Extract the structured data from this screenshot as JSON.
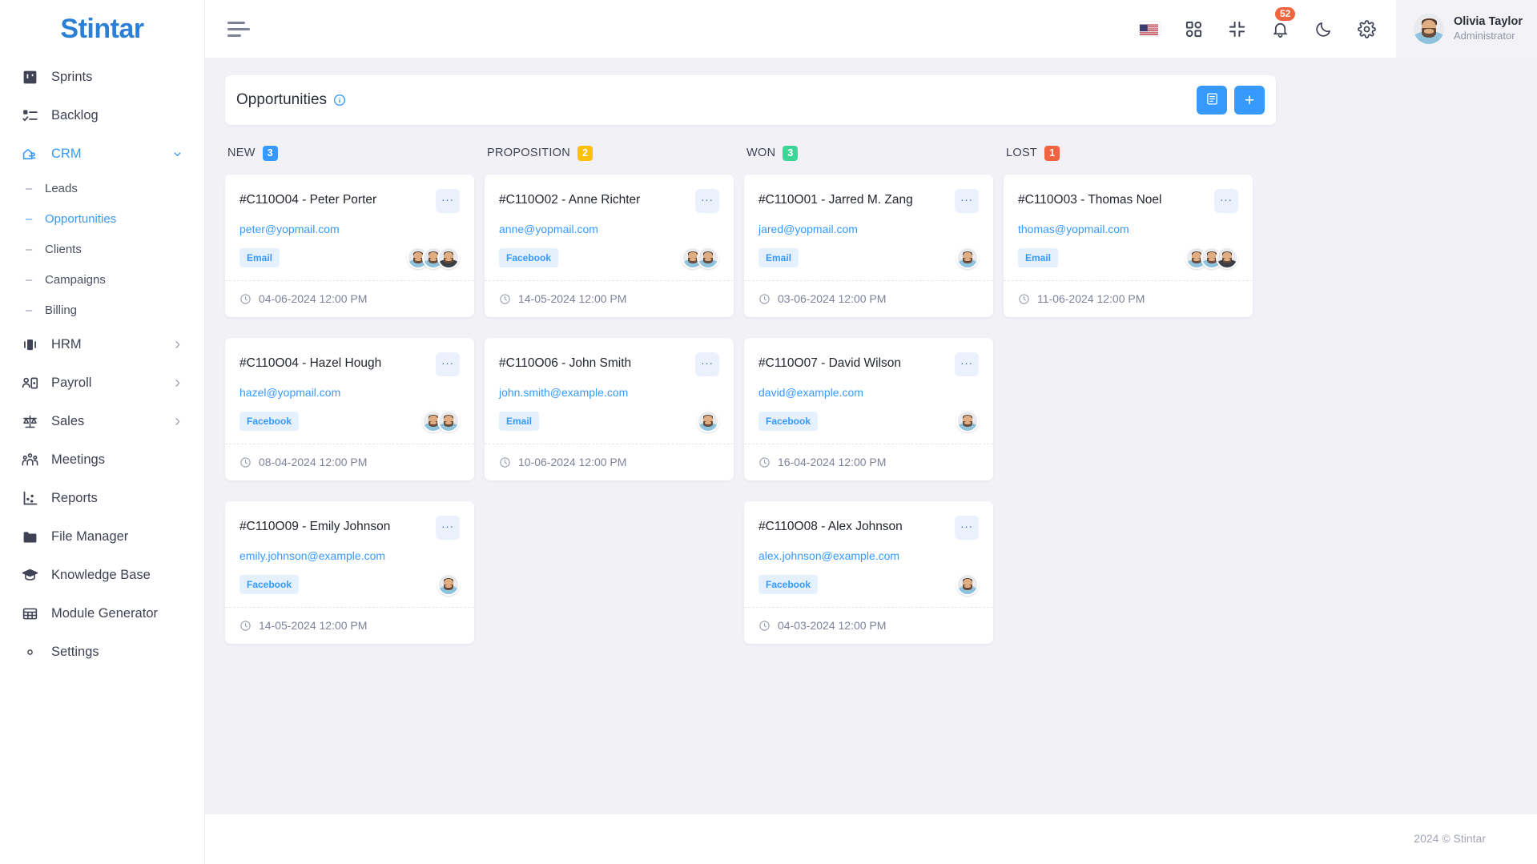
{
  "brand": {
    "name": "Stintar"
  },
  "sidebar": {
    "items": [
      {
        "label": "Sprints",
        "icon": "board-icon",
        "type": "item",
        "active": false
      },
      {
        "label": "Backlog",
        "icon": "checklist-icon",
        "type": "item",
        "active": false
      },
      {
        "label": "CRM",
        "icon": "crm-icon",
        "type": "group",
        "active": true,
        "expanded": true
      },
      {
        "label": "Leads",
        "icon": "dash-icon",
        "type": "sub",
        "active": false
      },
      {
        "label": "Opportunities",
        "icon": "dash-icon",
        "type": "sub",
        "active": true
      },
      {
        "label": "Clients",
        "icon": "dash-icon",
        "type": "sub",
        "active": false
      },
      {
        "label": "Campaigns",
        "icon": "dash-icon",
        "type": "sub",
        "active": false
      },
      {
        "label": "Billing",
        "icon": "dash-icon",
        "type": "sub",
        "active": false
      },
      {
        "label": "HRM",
        "icon": "hrm-icon",
        "type": "group",
        "active": false,
        "expanded": false
      },
      {
        "label": "Payroll",
        "icon": "payroll-icon",
        "type": "group",
        "active": false,
        "expanded": false
      },
      {
        "label": "Sales",
        "icon": "scales-icon",
        "type": "group",
        "active": false,
        "expanded": false
      },
      {
        "label": "Meetings",
        "icon": "people-icon",
        "type": "item",
        "active": false
      },
      {
        "label": "Reports",
        "icon": "chart-icon",
        "type": "item",
        "active": false
      },
      {
        "label": "File Manager",
        "icon": "folder-icon",
        "type": "item",
        "active": false
      },
      {
        "label": "Knowledge Base",
        "icon": "graduation-cap-icon",
        "type": "item",
        "active": false
      },
      {
        "label": "Module Generator",
        "icon": "grid-table-icon",
        "type": "item",
        "active": false
      },
      {
        "label": "Settings",
        "icon": "gear-icon",
        "type": "item",
        "active": false
      }
    ]
  },
  "topbar": {
    "menu_toggle": "hamburger-icon",
    "icons": [
      {
        "name": "language-flag-us",
        "label": "US"
      },
      {
        "name": "apps-grid-icon",
        "label": "Apps"
      },
      {
        "name": "fullscreen-exit-icon",
        "label": "Fullscreen"
      },
      {
        "name": "bell-icon",
        "label": "Notifications",
        "badge": "52"
      },
      {
        "name": "moon-icon",
        "label": "Dark mode"
      },
      {
        "name": "gear-icon",
        "label": "Settings"
      }
    ],
    "notification_count": "52",
    "profile": {
      "name": "Olivia Taylor",
      "role": "Administrator",
      "avatar": "user-avatar"
    }
  },
  "page": {
    "title": "Opportunities",
    "info_icon": "info-icon",
    "actions": [
      {
        "name": "list-view-button",
        "icon": "list-view-icon",
        "label": ""
      },
      {
        "name": "add-opportunity-button",
        "icon": "plus-icon",
        "label": "+"
      }
    ]
  },
  "colors": {
    "new": "#3699ff",
    "proposition": "#ffc107",
    "won": "#3dd598",
    "lost": "#f0653f",
    "accent": "#3699ff"
  },
  "board": {
    "columns": [
      {
        "name": "NEW",
        "count": "3",
        "badge_color": "#3699ff",
        "cards": [
          {
            "title": "#C110O04 - Peter Porter",
            "email": "peter@yopmail.com",
            "tag": "Email",
            "date": "04-06-2024 12:00 PM",
            "avatars": 3,
            "menu": "..."
          },
          {
            "title": "#C110O04 - Hazel Hough",
            "email": "hazel@yopmail.com",
            "tag": "Facebook",
            "date": "08-04-2024 12:00 PM",
            "avatars": 2,
            "menu": "..."
          },
          {
            "title": "#C110O09 - Emily Johnson",
            "email": "emily.johnson@example.com",
            "tag": "Facebook",
            "date": "14-05-2024 12:00 PM",
            "avatars": 1,
            "menu": "..."
          }
        ]
      },
      {
        "name": "PROPOSITION",
        "count": "2",
        "badge_color": "#ffc107",
        "cards": [
          {
            "title": "#C110O02 - Anne Richter",
            "email": "anne@yopmail.com",
            "tag": "Facebook",
            "date": "14-05-2024 12:00 PM",
            "avatars": 2,
            "menu": "..."
          },
          {
            "title": "#C110O06 - John Smith",
            "email": "john.smith@example.com",
            "tag": "Email",
            "date": "10-06-2024 12:00 PM",
            "avatars": 1,
            "menu": "..."
          }
        ]
      },
      {
        "name": "WON",
        "count": "3",
        "badge_color": "#3dd598",
        "cards": [
          {
            "title": "#C110O01 - Jarred M. Zang",
            "email": "jared@yopmail.com",
            "tag": "Email",
            "date": "03-06-2024 12:00 PM",
            "avatars": 1,
            "menu": "..."
          },
          {
            "title": "#C110O07 - David Wilson",
            "email": "david@example.com",
            "tag": "Facebook",
            "date": "16-04-2024 12:00 PM",
            "avatars": 1,
            "menu": "..."
          },
          {
            "title": "#C110O08 - Alex Johnson",
            "email": "alex.johnson@example.com",
            "tag": "Facebook",
            "date": "04-03-2024 12:00 PM",
            "avatars": 1,
            "menu": "..."
          }
        ]
      },
      {
        "name": "LOST",
        "count": "1",
        "badge_color": "#f0653f",
        "cards": [
          {
            "title": "#C110O03 - Thomas Noel",
            "email": "thomas@yopmail.com",
            "tag": "Email",
            "date": "11-06-2024 12:00 PM",
            "avatars": 3,
            "menu": "..."
          }
        ]
      }
    ]
  },
  "footer": {
    "text": "2024 © Stintar"
  }
}
